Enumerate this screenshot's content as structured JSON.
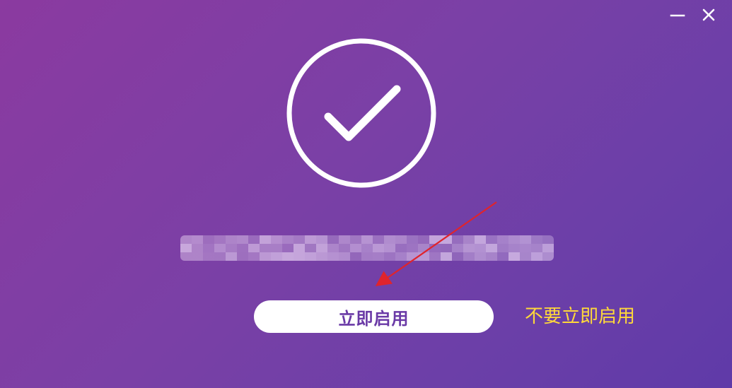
{
  "window": {
    "controls": {
      "minimize_icon": "minimize-icon",
      "close_icon": "close-icon"
    }
  },
  "status": {
    "icon": "checkmark-circle-icon",
    "message_obscured": true
  },
  "actions": {
    "primary_label": "立即启用",
    "secondary_label": "不要立即启用"
  },
  "colors": {
    "background_start": "#8b3aa0",
    "background_end": "#5f3aa8",
    "primary_button_bg": "#ffffff",
    "primary_button_text": "#6a3aa6",
    "secondary_text": "#ffd83a",
    "annotation_arrow": "#e0242c"
  }
}
